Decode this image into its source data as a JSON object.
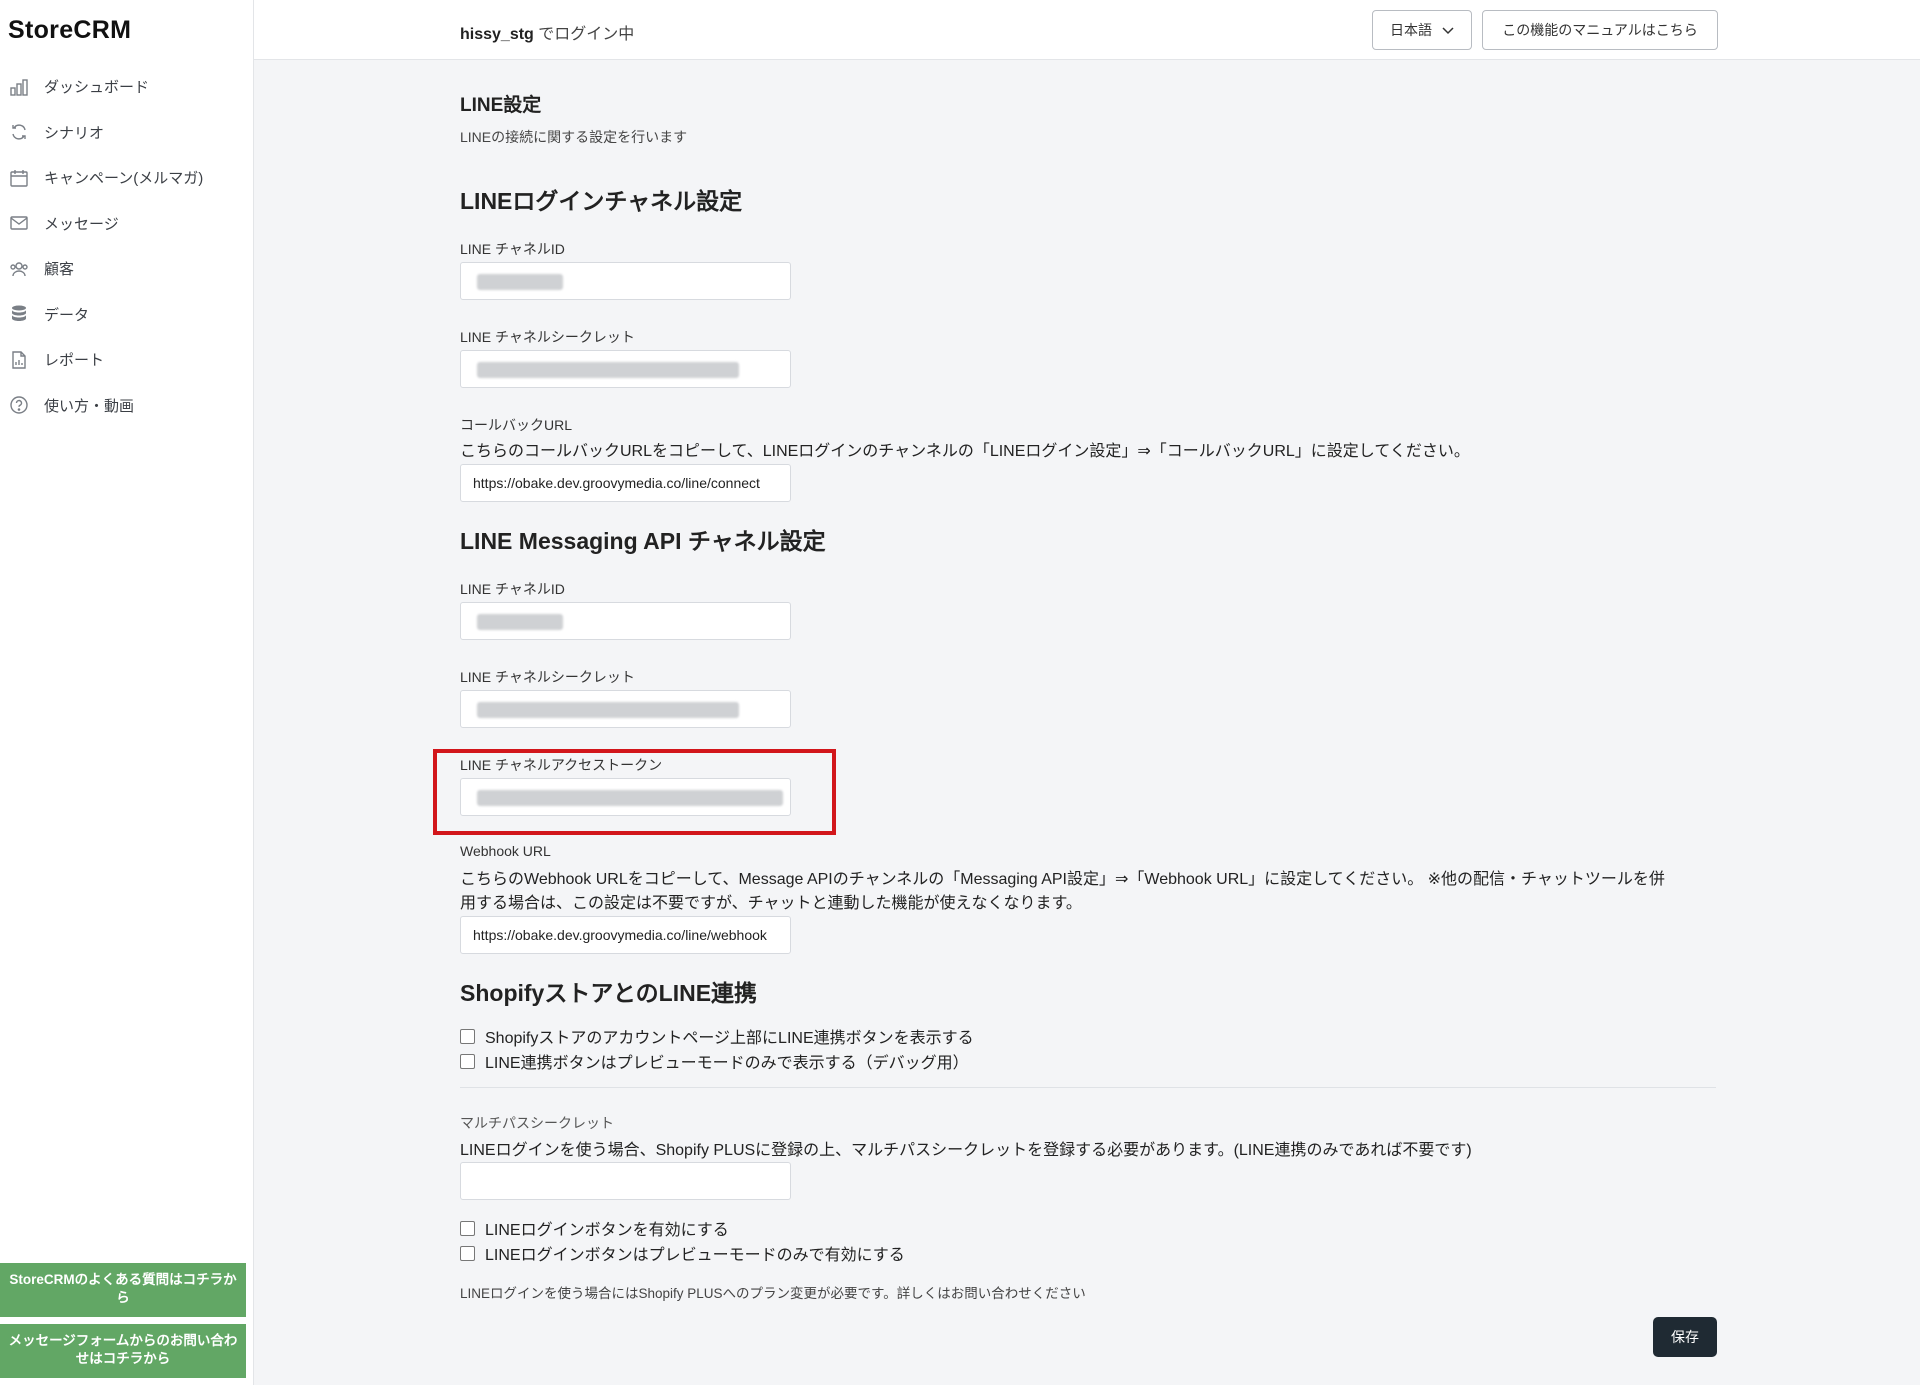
{
  "app": {
    "logo": "StoreCRM"
  },
  "sidebar": {
    "items": [
      {
        "label": "ダッシュボード",
        "icon": "bar-chart-icon"
      },
      {
        "label": "シナリオ",
        "icon": "refresh-icon"
      },
      {
        "label": "キャンペーン(メルマガ)",
        "icon": "calendar-icon"
      },
      {
        "label": "メッセージ",
        "icon": "mail-icon"
      },
      {
        "label": "顧客",
        "icon": "users-icon"
      },
      {
        "label": "データ",
        "icon": "database-icon"
      },
      {
        "label": "レポート",
        "icon": "report-icon"
      },
      {
        "label": "使い方・動画",
        "icon": "help-icon"
      }
    ],
    "faq_button": "StoreCRMのよくある質問はコチラから",
    "contact_button": "メッセージフォームからのお問い合わせはコチラから"
  },
  "header": {
    "user": "hissy_stg",
    "login_suffix": " でログイン中",
    "language": "日本語",
    "manual_button": "この機能のマニュアルはこちら"
  },
  "page": {
    "title": "LINE設定",
    "subtitle": "LINEの接続に関する設定を行います"
  },
  "login_channel": {
    "heading": "LINEログインチャネル設定",
    "channel_id_label": "LINE チャネルID",
    "channel_secret_label": "LINE チャネルシークレット",
    "callback_label": "コールバックURL",
    "callback_desc": "こちらのコールバックURLをコピーして、LINEログインのチャンネルの「LINEログイン設定」⇒「コールバックURL」に設定してください。",
    "callback_url": "https://obake.dev.groovymedia.co/line/connect"
  },
  "messaging_channel": {
    "heading": "LINE Messaging API チャネル設定",
    "channel_id_label": "LINE チャネルID",
    "channel_secret_label": "LINE チャネルシークレット",
    "access_token_label": "LINE チャネルアクセストークン",
    "webhook_label": "Webhook URL",
    "webhook_desc_1": "こちらのWebhook URLをコピーして、Message APIのチャンネルの「Messaging API設定」⇒「Webhook URL」に設定してください。 ※他の配信・チャットツールを併",
    "webhook_desc_2": "用する場合は、この設定は不要ですが、チャットと連動した機能が使えなくなります。",
    "webhook_url": "https://obake.dev.groovymedia.co/line/webhook"
  },
  "shopify": {
    "heading": "ShopifyストアとのLINE連携",
    "option_1": "Shopifyストアのアカウントページ上部にLINE連携ボタンを表示する",
    "option_2": "LINE連携ボタンはプレビューモードのみで表示する（デバッグ用）",
    "multipass_label": "マルチパスシークレット",
    "multipass_desc": "LINEログインを使う場合、Shopify PLUSに登録の上、マルチパスシークレットを登録する必要があります。(LINE連携のみであれば不要です)",
    "option_3": "LINEログインボタンを有効にする",
    "option_4": "LINEログインボタンはプレビューモードのみで有効にする",
    "note": "LINEログインを使う場合にはShopify PLUSへのプラン変更が必要です。詳しくはお問い合わせください"
  },
  "actions": {
    "save": "保存"
  },
  "colors": {
    "sidebar_button": "#62a765",
    "highlight": "#d2161b",
    "save_button": "#1f2a33"
  }
}
